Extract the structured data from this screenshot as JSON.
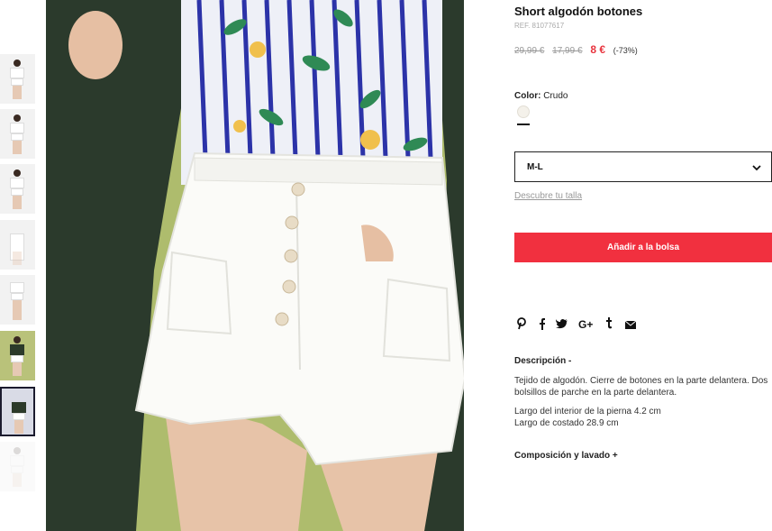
{
  "product": {
    "title": "Short algodón botones",
    "ref": "REF. 81077617",
    "price_original": "29,99 €",
    "price_previous": "17,99 €",
    "price_current": "8 €",
    "discount": "(-73%)"
  },
  "color": {
    "label": "Color:",
    "value": "Crudo",
    "swatch_hex": "#f4f1ea"
  },
  "size": {
    "selected": "M-L",
    "guide_link": "Descubre tu talla"
  },
  "add_to_bag": "Añadir a la bolsa",
  "accent_color": "#f1303f",
  "social": [
    {
      "name": "pinterest-icon",
      "glyph": "P"
    },
    {
      "name": "facebook-icon",
      "glyph": "f"
    },
    {
      "name": "twitter-icon",
      "glyph": "🐦"
    },
    {
      "name": "google-plus-icon",
      "glyph": "G+"
    },
    {
      "name": "tumblr-icon",
      "glyph": "t"
    },
    {
      "name": "email-icon",
      "glyph": "✉"
    }
  ],
  "description": {
    "heading": "Descripción  -",
    "lines": [
      "Tejido de algodón. Cierre de botones en la parte delantera. Dos bolsillos de parche en la parte delantera.",
      "Largo del interior de la pierna 4.2 cm\nLargo de costado 28.9 cm"
    ]
  },
  "composition": {
    "heading": "Composición y lavado  +"
  },
  "thumbnails": [
    "thumb-1",
    "thumb-2",
    "thumb-3",
    "thumb-4",
    "thumb-5",
    "thumb-6",
    "thumb-7",
    "thumb-8"
  ]
}
